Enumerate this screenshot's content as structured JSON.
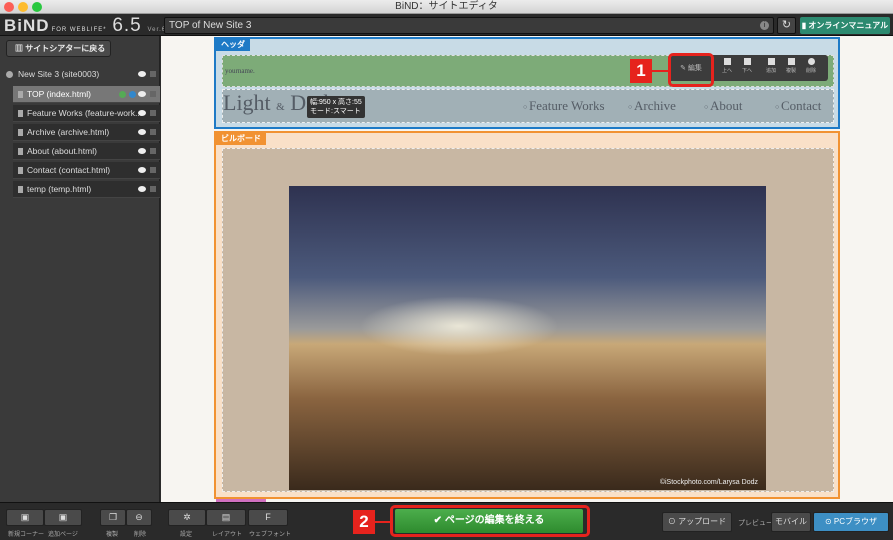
{
  "window": {
    "title": "BiND：サイトエディタ"
  },
  "app": {
    "logo": "BiND",
    "logo_sub": "FOR WEBLIFE*",
    "version_big": "6.5",
    "build": "Ver.6.50 (b1163)"
  },
  "toolbar": {
    "url": "TOP of New Site 3",
    "manual": "オンラインマニュアル"
  },
  "sidebar": {
    "back": "サイトシアターに戻る",
    "site": "New Site 3 (site0003)",
    "pages": [
      {
        "label": "TOP (index.html)",
        "selected": true
      },
      {
        "label": "Feature Works (feature-work..."
      },
      {
        "label": "Archive (archive.html)"
      },
      {
        "label": "About (about.html)"
      },
      {
        "label": "Contact (contact.html)"
      },
      {
        "label": "temp (temp.html)"
      }
    ]
  },
  "header_block": {
    "tag": "ヘッダ",
    "yourname": "yourname.",
    "brand": "Light",
    "brand_amp": "&",
    "brand_end": "Dark",
    "dims_line1": "幅:950 x 高さ:55",
    "dims_line2": "モード:スマート",
    "nav": [
      "Feature Works",
      "Archive",
      "About",
      "Contact"
    ],
    "tools": {
      "edit": "編集",
      "up": "上へ",
      "down": "下へ",
      "add": "追加",
      "copy": "複製",
      "delete": "削除"
    }
  },
  "billboard": {
    "tag": "ビルボード",
    "credit": "©iStockphoto.com/Larysa Dodz"
  },
  "callouts": [
    "1",
    "2"
  ],
  "bottom": {
    "new_corner": "新規コーナー",
    "add_page": "追加ページ",
    "duplicate": "複製",
    "delete": "削除",
    "settings": "設定",
    "layout": "レイアウト",
    "webfont": "ウェブフォント",
    "finish": "ページの編集を終える",
    "upload": "アップロード",
    "preview": "プレビュー",
    "mobile": "モバイル",
    "pc_browser": "PCブラウザ"
  },
  "colors": {
    "header_border": "#1e7ac6",
    "billboard_border": "#f19232",
    "finish_green": "#3a9d3a",
    "callout_red": "#e6231d",
    "manual_teal": "#2c8a70"
  }
}
